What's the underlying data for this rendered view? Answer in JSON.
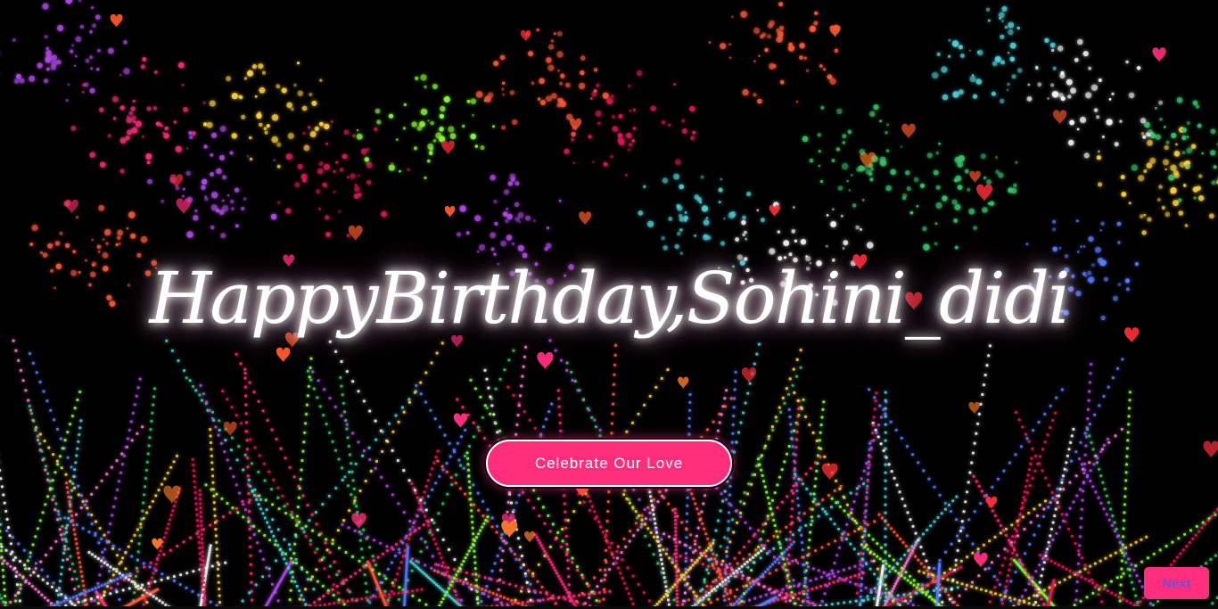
{
  "greeting": {
    "title": "HappyBirthday,Sohini_didi"
  },
  "actions": {
    "celebrate_label": "Celebrate Our Love",
    "next_label": "Next"
  },
  "colors": {
    "accent": "#ff2e7d",
    "background": "#000000",
    "next_text": "#7a4ad0"
  },
  "decor": {
    "particle_icon": "firework-particle",
    "float_icon": "heart-icon"
  }
}
